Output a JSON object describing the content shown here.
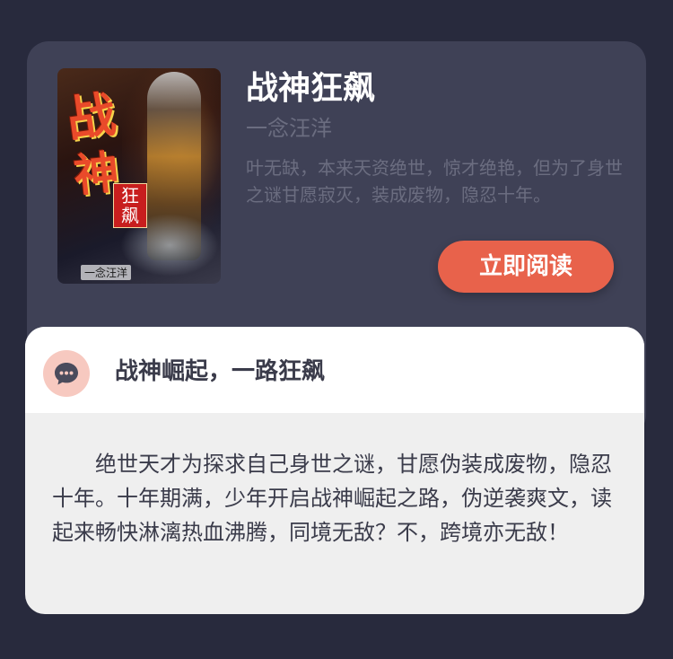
{
  "book": {
    "title": "战神狂飙",
    "author": "一念汪洋",
    "synopsis": "叶无缺，本来天资绝世，惊才绝艳，但为了身世之谜甘愿寂灭，装成废物，隐忍十年。",
    "read_button_label": "立即阅读",
    "cover": {
      "title_char_1": "战",
      "title_char_2": "神",
      "title_sub": "狂飙",
      "author_tag": "一念汪洋"
    }
  },
  "comment": {
    "icon": "chat-bubble-icon",
    "title": "战神崛起，一路狂飙",
    "body": "绝世天才为探求自己身世之谜，甘愿伪装成废物，隐忍十年。十年期满，少年开启战神崛起之路，伪逆袭爽文，读起来畅快淋漓热血沸腾，同境无敌？不，跨境亦无敌！"
  },
  "colors": {
    "background": "#282a3d",
    "card": "#3f4156",
    "accent": "#e8624b",
    "icon_bg": "#f7c9c0",
    "muted_text": "#6b6d80"
  }
}
